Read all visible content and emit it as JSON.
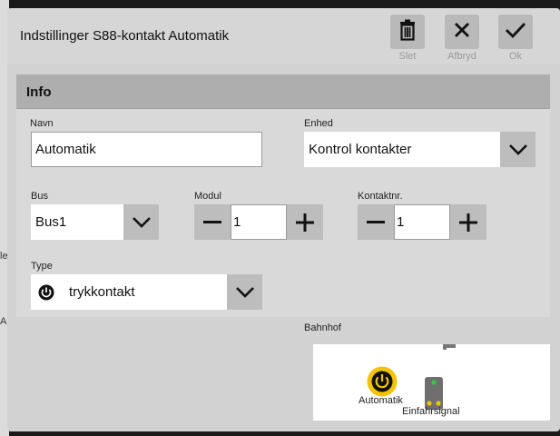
{
  "background": {
    "edge_labels": [
      "le",
      "A"
    ]
  },
  "dialog": {
    "title": "Indstillinger S88-kontakt Automatik",
    "actions": [
      {
        "label": "Slet",
        "icon": "trash-icon"
      },
      {
        "label": "Afbryd",
        "icon": "close-icon"
      },
      {
        "label": "Ok",
        "icon": "check-icon"
      }
    ]
  },
  "info": {
    "heading": "Info",
    "name": {
      "label": "Navn",
      "value": "Automatik"
    },
    "device": {
      "label": "Enhed",
      "value": "Kontrol kontakter"
    },
    "bus": {
      "label": "Bus",
      "value": "Bus1"
    },
    "module": {
      "label": "Modul",
      "value": "1"
    },
    "contact": {
      "label": "Kontaktnr.",
      "value": "1"
    },
    "type": {
      "label": "Type",
      "value": "trykkontakt",
      "icon": "power-icon"
    }
  },
  "layout_preview": {
    "label": "Bahnhof",
    "items": [
      {
        "label": "Automatik",
        "icon": "power-icon"
      },
      {
        "label": "Einfahrsignal",
        "icon": "signal-icon"
      }
    ]
  },
  "colors": {
    "accent_yellow": "#f2c400",
    "signal_green": "#2ecc40"
  }
}
